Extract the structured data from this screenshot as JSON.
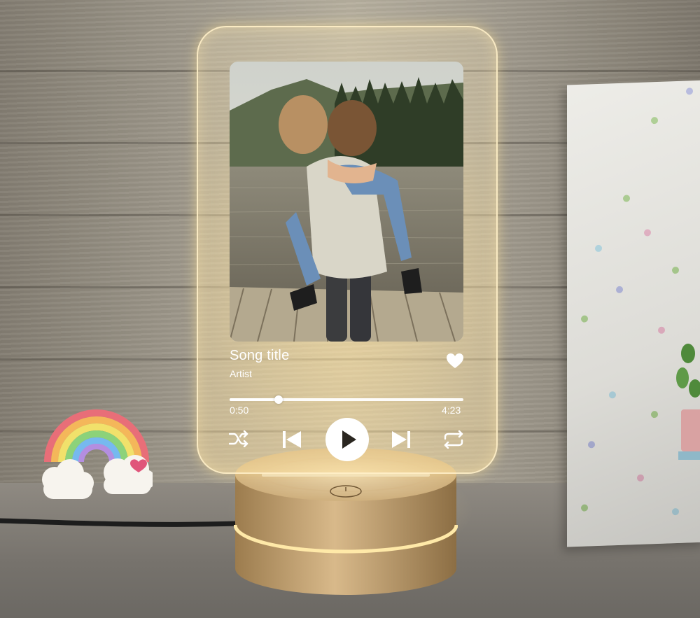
{
  "player": {
    "song_title": "Song title",
    "artist": "Artist",
    "current_time": "0:50",
    "total_time": "4:23",
    "progress": 0.21,
    "liked": true
  },
  "controls": {
    "shuffle_icon": "shuffle-icon",
    "previous_icon": "skip-previous-icon",
    "play_icon": "play-icon",
    "next_icon": "skip-next-icon",
    "repeat_icon": "repeat-icon",
    "heart_icon": "heart-icon"
  },
  "colors": {
    "panel_glow": "#ffe6a6",
    "ui_foreground": "#ffffff",
    "base_wood": "#c9a874"
  }
}
